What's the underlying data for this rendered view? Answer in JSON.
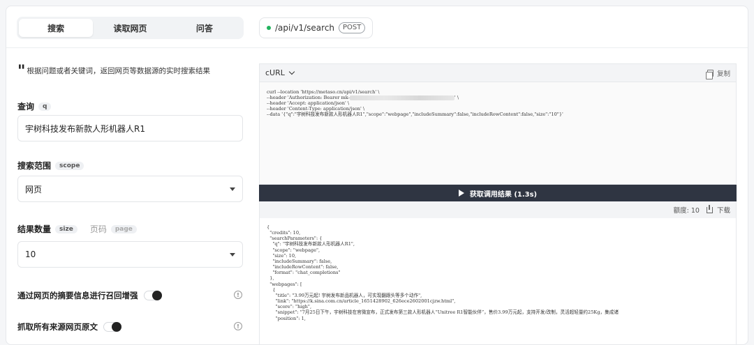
{
  "tabs": [
    {
      "label": "搜索",
      "active": true
    },
    {
      "label": "读取网页",
      "active": false
    },
    {
      "label": "问答",
      "active": false
    }
  ],
  "endpoint": {
    "path": "/api/v1/search",
    "method": "POST",
    "status_color": "#22b35e"
  },
  "description": "根据问题或者关键词，返回网页等数据源的实时搜索结果",
  "form": {
    "query_label": "查询",
    "query_key": "q",
    "query_value": "宇树科技发布新款人形机器人R1",
    "scope_label": "搜索范围",
    "scope_key": "scope",
    "scope_value": "网页",
    "size_label": "结果数量",
    "size_key": "size",
    "page_label": "页码",
    "page_key": "page",
    "size_value": "10",
    "summary_toggle_label": "通过网页的摘要信息进行召回增强",
    "raw_toggle_label": "抓取所有来源网页原文"
  },
  "code": {
    "language": "cURL",
    "copy_label": "复制",
    "lines": {
      "l1": "curl --location 'https://metaso.cn/api/v1/search' \\",
      "l2a": "--header 'Authorization: Bearer mk-",
      "l2b": "' \\",
      "l3": "--header 'Accept: application/json' \\",
      "l4": "--header 'Content-Type: application/json' \\",
      "l5": "--data '{\"q\":\"宇树科技发布新款人形机器人R1\",\"scope\":\"webpage\",\"includeSummary\":false,\"includeRowContent\":false,\"size\":\"10\"}'"
    }
  },
  "run_button": "获取调用结果 (1.3s)",
  "result": {
    "credits_label": "额度: 10",
    "download_label": "下载",
    "json_lines": [
      "{",
      "  \"credits\": 10,",
      "  \"searchParameters\": {",
      "    \"q\": \"宇树科技发布新款人形机器人R1\",",
      "    \"scope\": \"webpage\",",
      "    \"size\": 10,",
      "    \"includeSummary\": false,",
      "    \"includeRowContent\": false,",
      "    \"format\": \"chat_completions\"",
      "  },",
      "  \"webpages\": [",
      "    {",
      "      \"title\": \"3.99万元起! 宇树发布新品机器人，可实现翻跟头等多个动作\",",
      "      \"link\": \"https://k.sina.com.cn/article_1651428902_626ece2602001cjzw.html\",",
      "      \"score\": \"high\",",
      "      \"snippet\": \"7月25日下午，宇树科技在官微宣布，正式发布第三款人形机器人“Unitree R1智能伙伴”，售价3.99万元起，支持开发/改制，灵活超轻量约25Kg，集成诸",
      "      \"position\": 1,"
    ]
  }
}
